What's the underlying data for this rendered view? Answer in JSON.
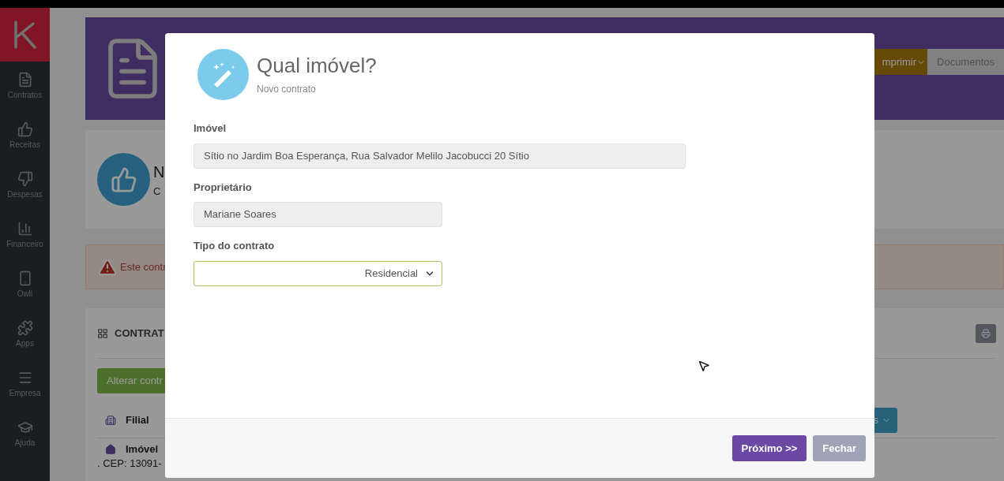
{
  "sidebar": {
    "items": [
      {
        "label": "Contratos"
      },
      {
        "label": "Receitas"
      },
      {
        "label": "Despesas"
      },
      {
        "label": "Financeiro"
      },
      {
        "label": "Owli"
      },
      {
        "label": "Apps"
      },
      {
        "label": "Empresa"
      },
      {
        "label": "Ajuda"
      }
    ]
  },
  "header": {
    "buttons": [
      {
        "label": "mprimir",
        "kind": "dropdown"
      },
      {
        "label": "Documentos",
        "kind": "plain"
      }
    ]
  },
  "summary_card": {
    "title": "N",
    "subtitle": "C"
  },
  "alert": {
    "text": "Este contr"
  },
  "contracts": {
    "heading": "CONTRAT",
    "action": "Alterar contr",
    "dropdown_label": "s",
    "rows": [
      {
        "label": "Filial",
        "kind": "branch"
      },
      {
        "label": "Imóvel",
        "kind": "property",
        "detail": ". CEP: 13091-"
      }
    ]
  },
  "modal": {
    "title": "Qual imóvel?",
    "subtitle": "Novo contrato",
    "fields": [
      {
        "kind": "readonly",
        "label": "Imóvel",
        "value": "Sítio no Jardim Boa Esperança, Rua Salvador Melilo Jacobucci 20  Sítio",
        "wide": true
      },
      {
        "kind": "readonly",
        "label": "Proprietário",
        "value": "Mariane Soares",
        "wide": false
      },
      {
        "kind": "select",
        "label": "Tipo do contrato",
        "value": "Residencial",
        "wide": false
      }
    ],
    "buttons": [
      {
        "label": "Próximo >>",
        "kind": "primary"
      },
      {
        "label": "Fechar",
        "kind": "secondary"
      }
    ]
  }
}
